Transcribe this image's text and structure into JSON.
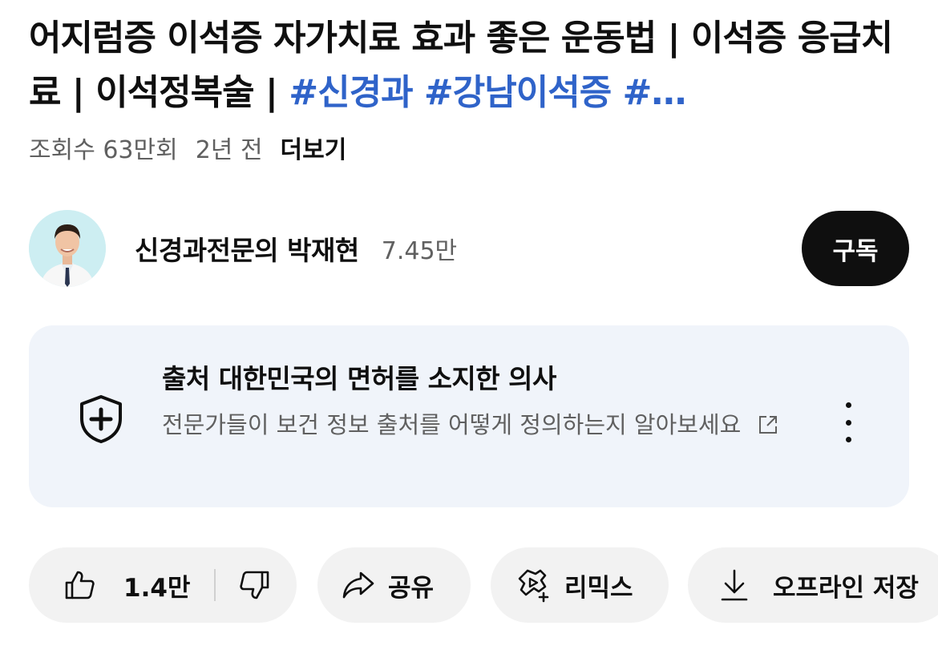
{
  "video": {
    "title": "어지럼증 이석증 자가치료 효과 좋은 운동법 | 이석증 응급치료 | 이석정복술 | ",
    "hashtags": "#신경과 #강남이석증 #…",
    "views": "조회수 63만회",
    "age": "2년 전",
    "more_label": "더보기"
  },
  "channel": {
    "name": "신경과전문의 박재현",
    "subscribers": "7.45만",
    "subscribe_label": "구독",
    "avatar_icon": "doctor-avatar"
  },
  "info_card": {
    "heading": "출처 대한민국의 면허를 소지한 의사",
    "description": "전문가들이 보건 정보 출처를 어떻게 정의하는지 알아보세요",
    "icon": "shield-plus-icon",
    "link_icon": "external-link-icon",
    "menu_icon": "more-vert-icon",
    "background": "#f0f4fa"
  },
  "actions": {
    "like_count": "1.4만",
    "share_label": "공유",
    "remix_label": "리믹스",
    "download_label": "오프라인 저장"
  },
  "colors": {
    "hashtag": "#2f63c9",
    "subscribe_bg": "#0f0f0f",
    "pill_bg": "#f2f2f2",
    "secondary_text": "#606060"
  }
}
